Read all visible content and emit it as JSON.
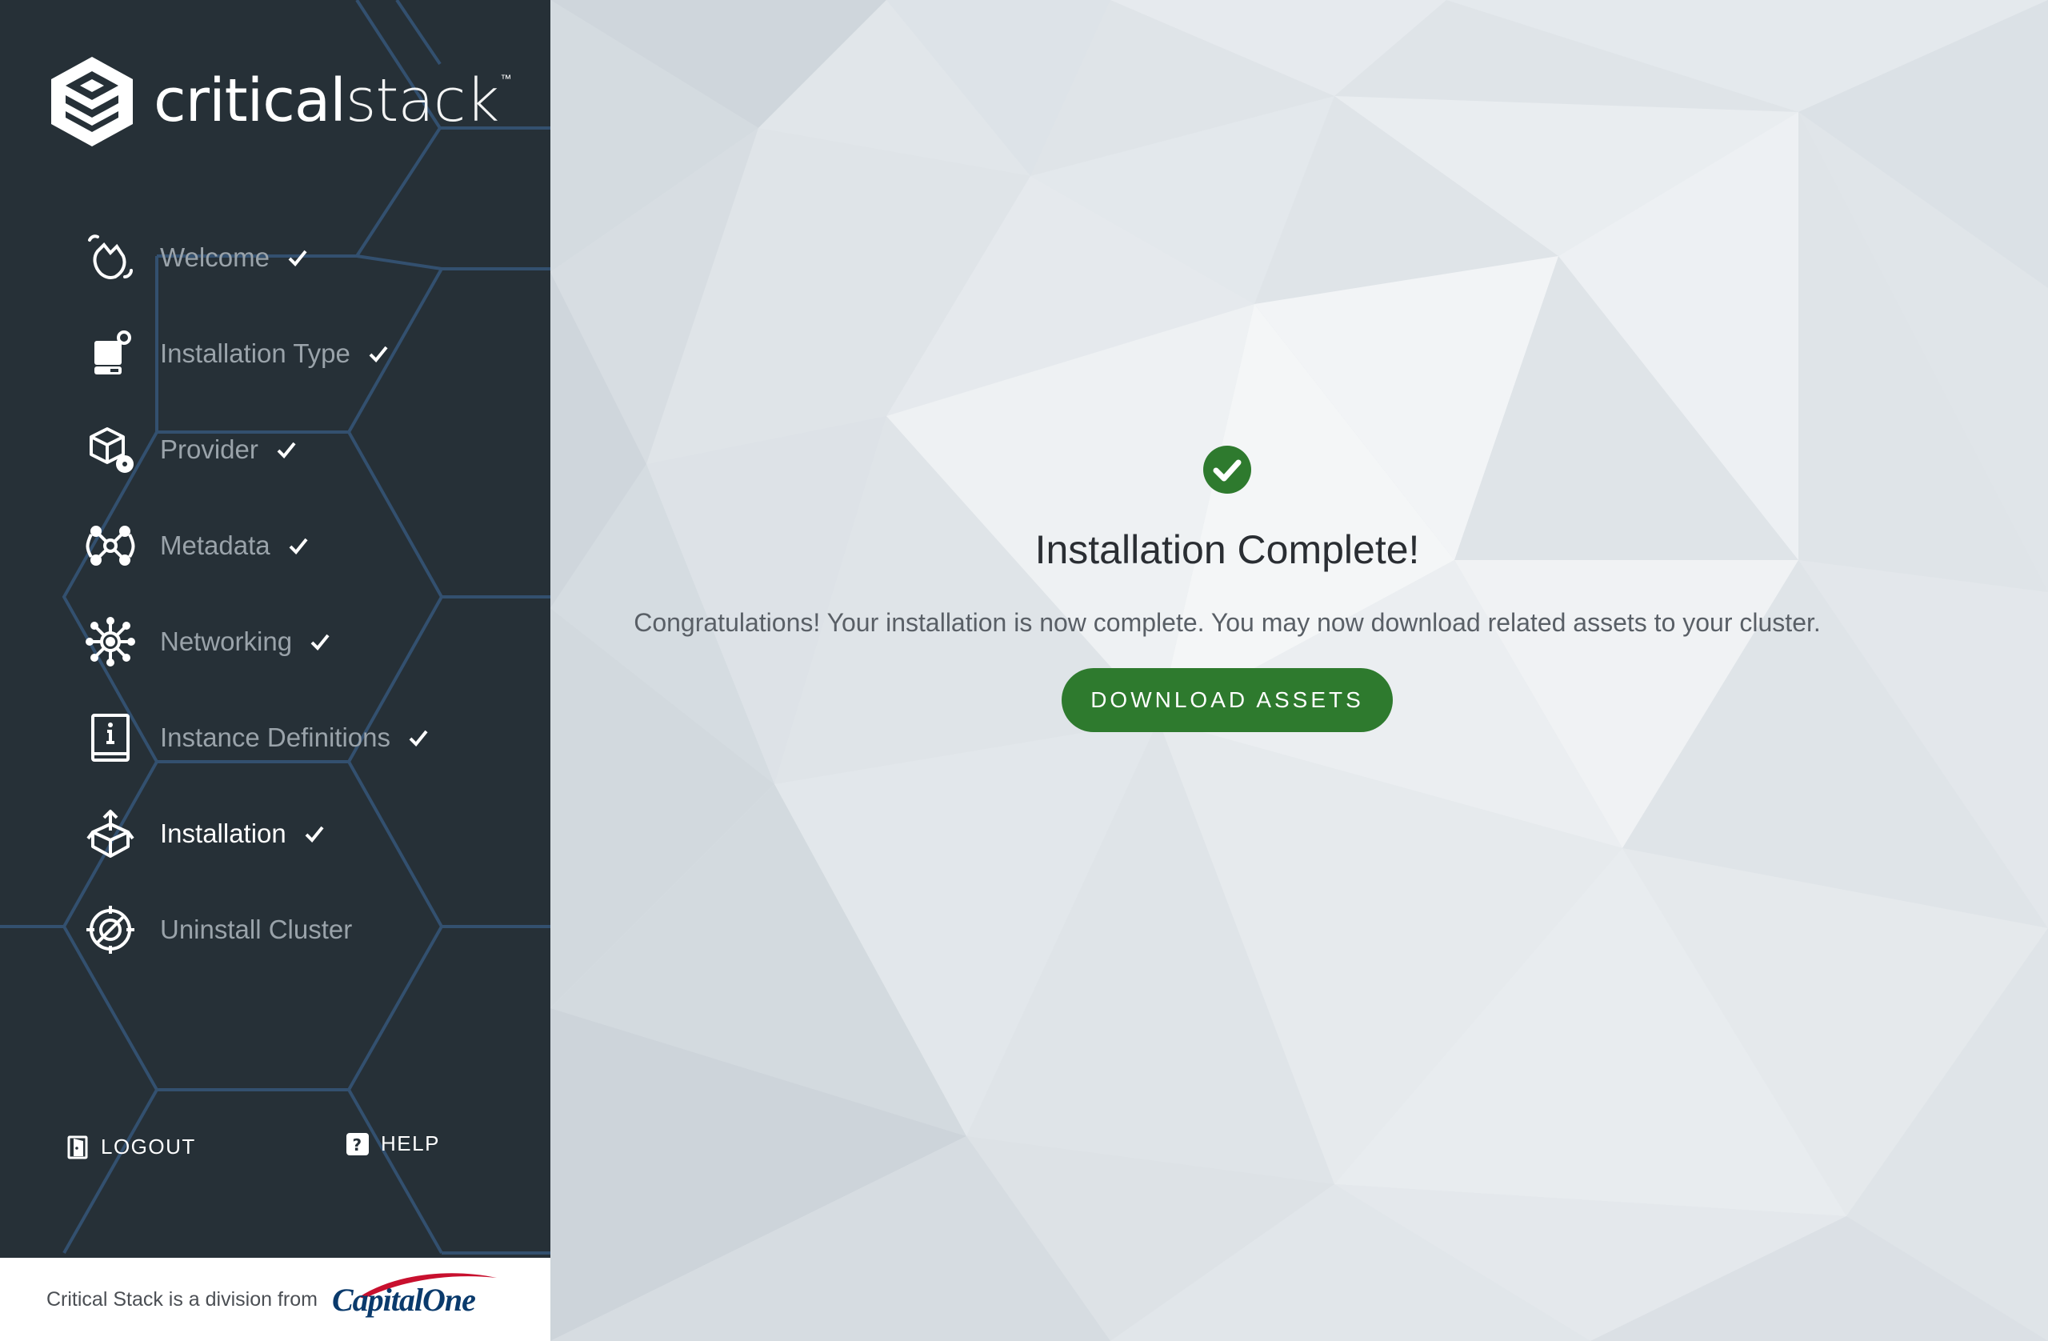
{
  "brand": {
    "wordmark_part1": "critical",
    "wordmark_part2": "stack",
    "trademark": "™"
  },
  "nav": {
    "items": [
      {
        "label": "Welcome",
        "icon": "waving-hand-icon",
        "completed": true
      },
      {
        "label": "Installation Type",
        "icon": "server-gear-icon",
        "completed": true
      },
      {
        "label": "Provider",
        "icon": "cube-gear-icon",
        "completed": true
      },
      {
        "label": "Metadata",
        "icon": "nodes-icon",
        "completed": true
      },
      {
        "label": "Networking",
        "icon": "network-hub-icon",
        "completed": true
      },
      {
        "label": "Instance Definitions",
        "icon": "info-book-icon",
        "completed": true
      },
      {
        "label": "Installation",
        "icon": "box-upload-icon",
        "completed": true,
        "active": true
      },
      {
        "label": "Uninstall Cluster",
        "icon": "crosshair-slash-icon",
        "completed": false
      }
    ]
  },
  "footer": {
    "logout_label": "LOGOUT",
    "help_label": "HELP",
    "division_text": "Critical Stack is a division from",
    "partner_logo_text": "CapitalOne"
  },
  "main": {
    "title": "Installation Complete!",
    "message": "Congratulations! Your installation is now complete. You may now download related assets to your cluster.",
    "download_button": "DOWNLOAD ASSETS"
  },
  "colors": {
    "sidebar_bg": "#263037",
    "hex_line": "#33506f",
    "accent_green": "#2e7a2e",
    "nav_text": "#9aa3aa",
    "nav_text_active": "#ffffff"
  }
}
